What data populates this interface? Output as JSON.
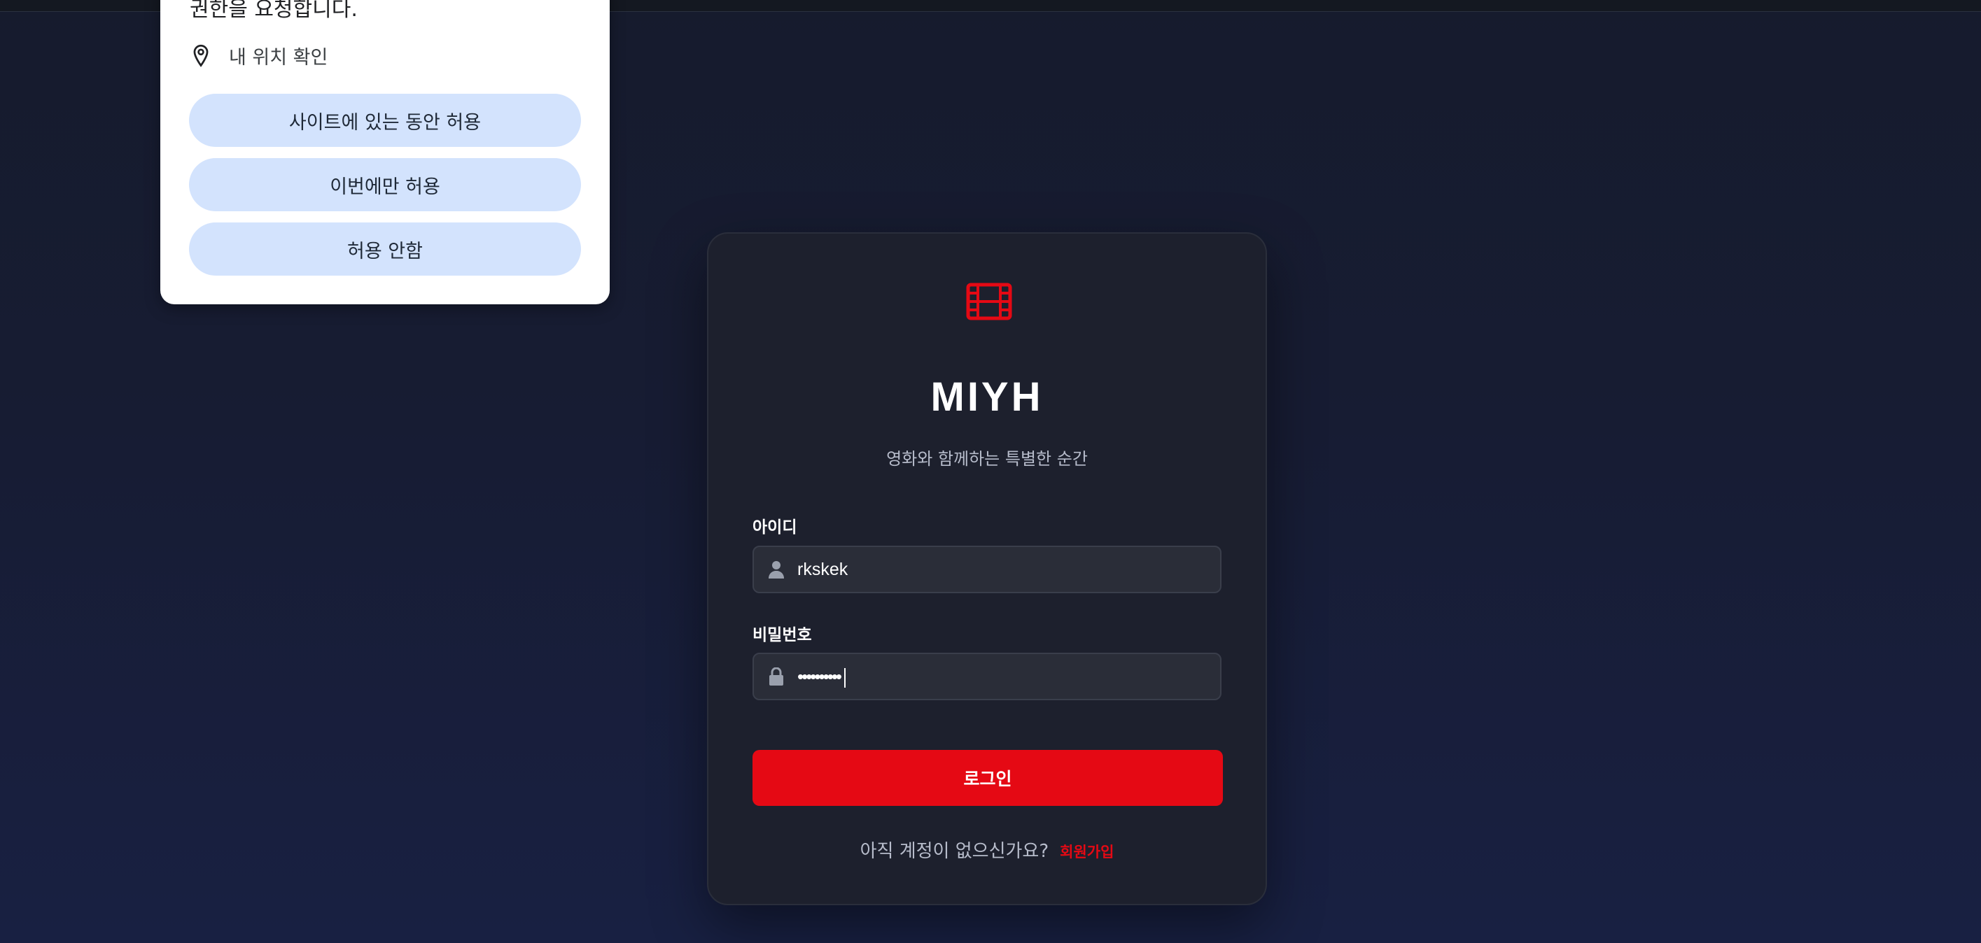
{
  "permission_popup": {
    "description": "권한을 요청합니다.",
    "permission_label": "내 위치 확인",
    "permission_icon": "location-pin-icon",
    "buttons": [
      {
        "label": "사이트에 있는 동안 허용"
      },
      {
        "label": "이번에만 허용"
      },
      {
        "label": "허용 안함"
      }
    ]
  },
  "login": {
    "logo_icon": "film-icon",
    "brand": "MIYH",
    "tagline": "영화와 함께하는 특별한 순간",
    "username": {
      "label": "아이디",
      "value": "rkskek",
      "icon": "user-icon"
    },
    "password": {
      "label": "비밀번호",
      "masked_value": "••••••••••",
      "icon": "lock-icon"
    },
    "submit_label": "로그인",
    "signup_prompt": "아직 계정이 없으신가요?",
    "signup_link": "회원가입"
  },
  "colors": {
    "accent": "#e50914",
    "card_bg": "#1d202d",
    "popup_button_bg": "#d3e3fd"
  }
}
